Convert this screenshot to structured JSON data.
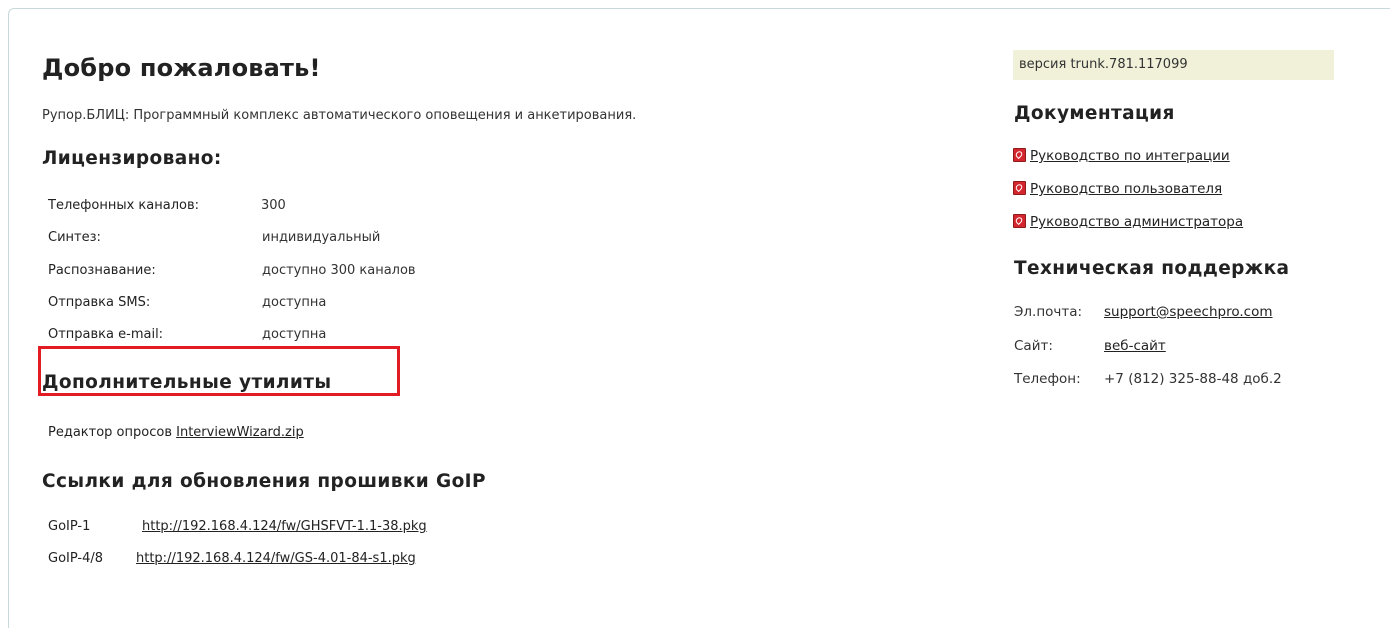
{
  "main": {
    "title": "Добро пожаловать!",
    "subtitle": "Рупор.БЛИЦ: Программный комплекс автоматического оповещения и анкетирования.",
    "licensed": {
      "heading": "Лицензировано:",
      "rows": [
        {
          "label": "Телефонных каналов:",
          "value": "300"
        },
        {
          "label": "Синтез:",
          "value": "индивидуальный"
        },
        {
          "label": "Распознавание:",
          "value": "доступно 300 каналов"
        },
        {
          "label": "Отправка SMS:",
          "value": "доступна"
        },
        {
          "label": "Отправка e-mail:",
          "value": "доступна"
        }
      ]
    },
    "utilities": {
      "heading": "Дополнительные утилиты",
      "editor_label": "Редактор опросов",
      "editor_link": "InterviewWizard.zip"
    },
    "firmware": {
      "heading": "Ссылки для обновления прошивки GoIP",
      "rows": [
        {
          "label": "GoIP-1",
          "link": "http://192.168.4.124/fw/GHSFVT-1.1-38.pkg"
        },
        {
          "label": "GoIP-4/8",
          "link": "http://192.168.4.124/fw/GS-4.01-84-s1.pkg"
        }
      ]
    }
  },
  "side": {
    "version": "версия trunk.781.117099",
    "docs": {
      "heading": "Документация",
      "items": [
        {
          "label": "Руководство по интеграции",
          "icon": "pdf-icon"
        },
        {
          "label": "Руководство пользователя",
          "icon": "pdf-icon"
        },
        {
          "label": "Руководство администратора",
          "icon": "pdf-icon"
        }
      ]
    },
    "support": {
      "heading": "Техническая поддержка",
      "email_label": "Эл.почта:",
      "email": "support@speechpro.com",
      "site_label": "Сайт:",
      "site": "веб-сайт",
      "phone_label": "Телефон:",
      "phone": "+7 (812) 325-88-48 доб.2"
    }
  },
  "colors": {
    "highlight": "#e31b23",
    "version_bg": "#f1f1d9",
    "pdf_red": "#d3262e"
  }
}
